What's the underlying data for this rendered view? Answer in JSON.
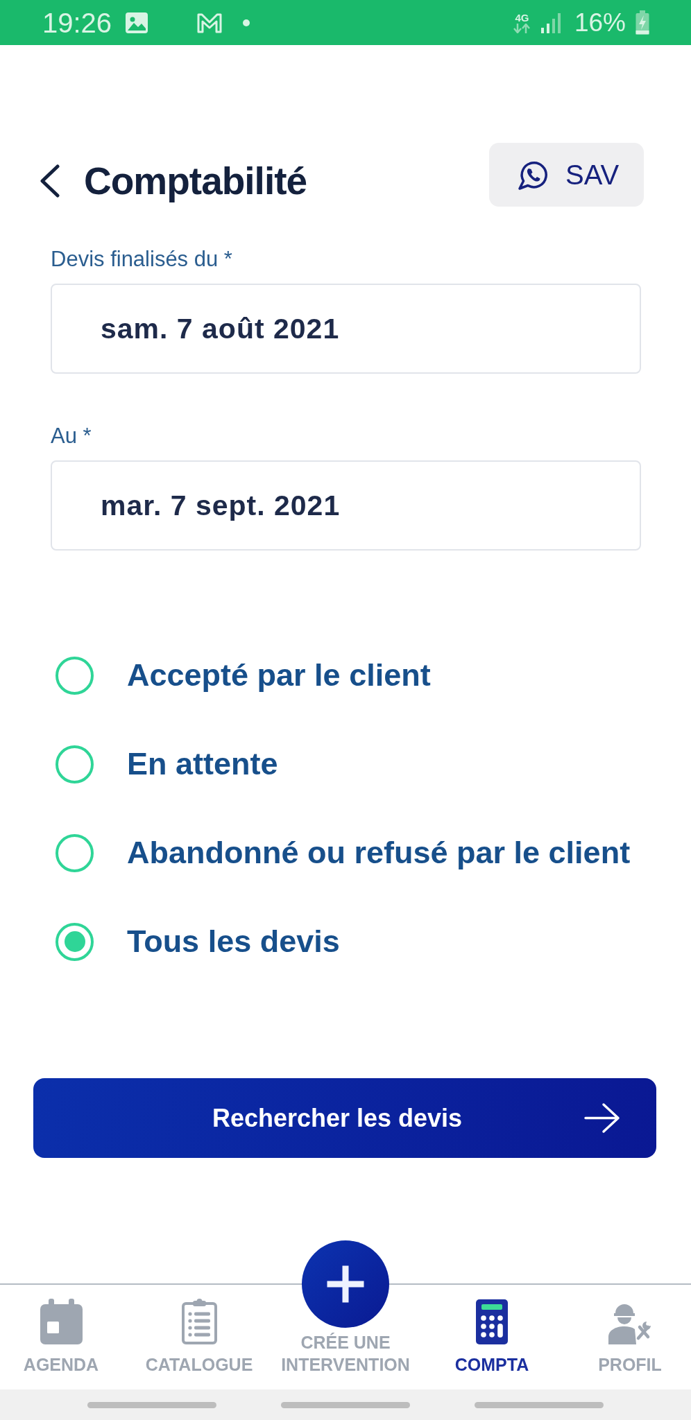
{
  "status_bar": {
    "time": "19:26",
    "network": "4G",
    "battery": "16%"
  },
  "header": {
    "title": "Comptabilité",
    "support_button": "SAV"
  },
  "date_fields": [
    {
      "label": "Devis finalisés du *",
      "value": "sam. 7 août 2021"
    },
    {
      "label": "Au *",
      "value": "mar. 7 sept. 2021"
    }
  ],
  "status_options": [
    {
      "label": "Accepté par le client",
      "selected": false
    },
    {
      "label": "En attente",
      "selected": false
    },
    {
      "label": "Abandonné ou refusé par le client",
      "selected": false
    },
    {
      "label": "Tous les devis",
      "selected": true
    }
  ],
  "search_button": "Rechercher les devis",
  "bottom_nav": {
    "items": [
      {
        "label": "AGENDA",
        "kind": "tab",
        "selected": false
      },
      {
        "label": "CATALOGUE",
        "kind": "tab",
        "selected": false
      },
      {
        "label": "CRÉE UNE INTERVENTION",
        "kind": "action",
        "selected": false
      },
      {
        "label": "COMPTA",
        "kind": "tab",
        "selected": true
      },
      {
        "label": "PROFIL",
        "kind": "tab",
        "selected": false
      }
    ]
  }
}
